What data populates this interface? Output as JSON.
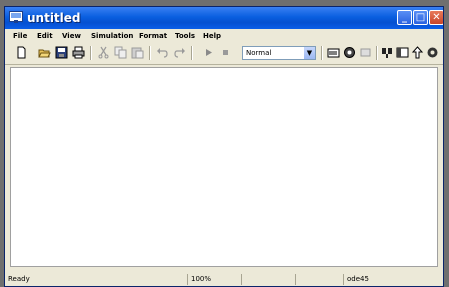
{
  "window": {
    "title": "untitled"
  },
  "menu": [
    "File",
    "Edit",
    "View",
    "Simulation",
    "Format",
    "Tools",
    "Help"
  ],
  "toolbar": {
    "icons": [
      "new-model-icon",
      "open-icon",
      "save-icon",
      "print-icon",
      "cut-icon",
      "copy-icon",
      "paste-icon",
      "undo-icon",
      "redo-icon",
      "start-simulation-icon",
      "stop-simulation-icon",
      "library-browser-icon",
      "model-explorer-icon",
      "debugger-icon",
      "build-icon",
      "toggle-model-browser-icon",
      "go-to-parent-icon",
      "settings-icon"
    ],
    "simulation_mode": "Normal"
  },
  "status": {
    "state": "Ready",
    "zoom": "100%",
    "solver": "ode45"
  }
}
